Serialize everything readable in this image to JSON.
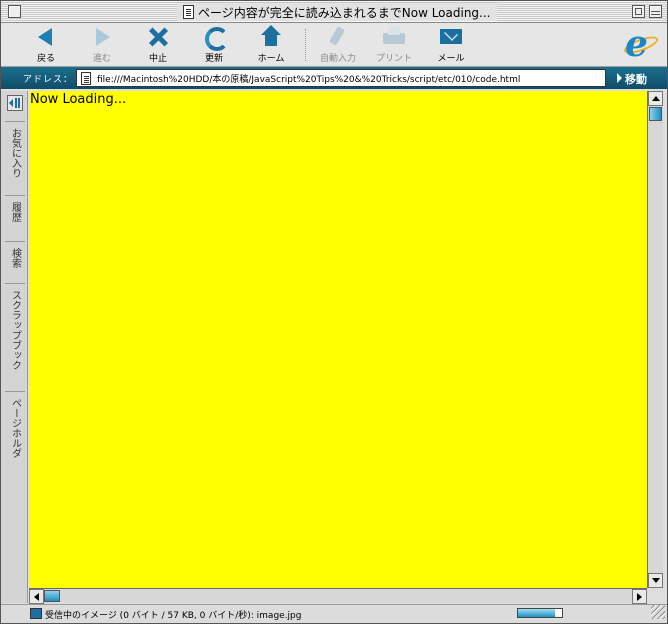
{
  "window": {
    "title": "ページ内容が完全に読み込まれるまでNow Loading..."
  },
  "toolbar": {
    "buttons": [
      {
        "label": "戻る",
        "icon": "back-arrow-icon",
        "enabled": true
      },
      {
        "label": "進む",
        "icon": "forward-arrow-icon",
        "enabled": false
      },
      {
        "label": "中止",
        "icon": "stop-x-icon",
        "enabled": true
      },
      {
        "label": "更新",
        "icon": "refresh-icon",
        "enabled": true
      },
      {
        "label": "ホーム",
        "icon": "home-icon",
        "enabled": true
      },
      {
        "label": "自動入力",
        "icon": "autofill-pen-icon",
        "enabled": false
      },
      {
        "label": "プリント",
        "icon": "printer-icon",
        "enabled": false
      },
      {
        "label": "メール",
        "icon": "mail-icon",
        "enabled": true
      }
    ],
    "logo_icon": "internet-explorer-logo"
  },
  "address": {
    "label": "アドレス：",
    "url": "file:///Macintosh%20HDD/本の原稿/JavaScript%20Tips%20&%20Tricks/script/etc/010/code.html",
    "go_label": "移動"
  },
  "sidebar": {
    "tabs": [
      "お気に入り",
      "履歴",
      "検索",
      "スクラップブック",
      "ページホルダ"
    ]
  },
  "content": {
    "text": "Now Loading...",
    "background": "#ffff00"
  },
  "status": {
    "text": "受信中のイメージ (0 バイト / 57 KB, 0 バイト/秒): image.jpg",
    "progress_fraction": 0.85
  },
  "colors": {
    "accent": "#1d6fa0",
    "address_bar": "#1c6f8e",
    "page_background": "#ffff00"
  }
}
